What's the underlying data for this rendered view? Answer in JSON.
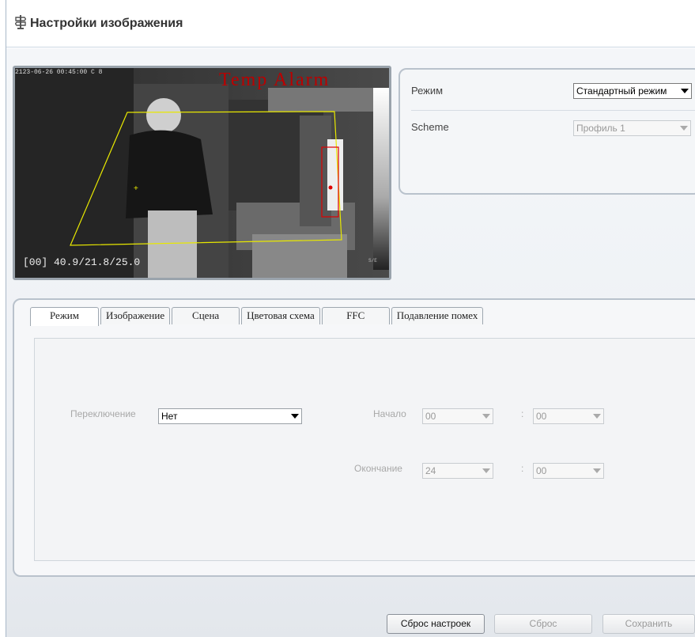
{
  "header": {
    "title": "Настройки изображения",
    "icon": "settings-sign-icon"
  },
  "video": {
    "timestamp": "2123-06-26 00:45:00 C 8",
    "alarm_text": "Temp Alarm",
    "temperature": "[00] 40.9/21.8/25.0",
    "corner_text": "S/E"
  },
  "mode_panel": {
    "mode_label": "Режим",
    "mode_value": "Стандартный режим",
    "scheme_label": "Scheme",
    "scheme_value": "Профиль 1"
  },
  "tabs": [
    {
      "label": "Режим",
      "active": true
    },
    {
      "label": "Изображение",
      "active": false
    },
    {
      "label": "Сцена",
      "active": false
    },
    {
      "label": "Цветовая схема",
      "active": false
    },
    {
      "label": "FFC",
      "active": false
    },
    {
      "label": "Подавление помех",
      "active": false
    }
  ],
  "mode_tab": {
    "switch_label": "Переключение",
    "switch_value": "Нет",
    "start_label": "Начало",
    "start_hour": "00",
    "start_min": "00",
    "end_label": "Окончание",
    "end_hour": "24",
    "end_min": "00",
    "separator": ":"
  },
  "footer": {
    "reset_defaults": "Сброс настроек",
    "reset": "Сброс",
    "save": "Сохранить"
  },
  "colors": {
    "alarm": "#b00000",
    "roi": "#e8e800",
    "target_box": "#e00000"
  }
}
